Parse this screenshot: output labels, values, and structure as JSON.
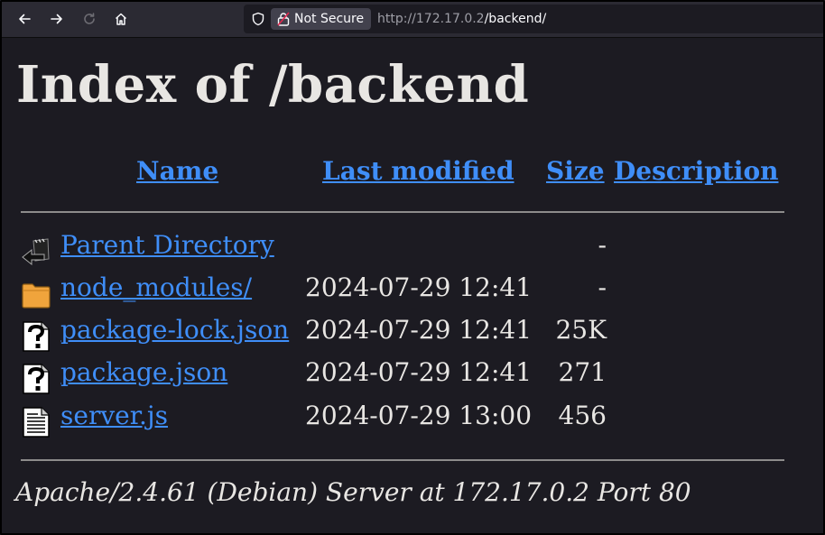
{
  "browser": {
    "security_label": "Not Secure",
    "url_host": "http://172.17.0.2",
    "url_path": "/backend/",
    "icons": [
      "back-icon",
      "forward-icon",
      "reload-icon",
      "home-icon",
      "shield-icon",
      "lock-warning-icon"
    ]
  },
  "page": {
    "title": "Index of /backend",
    "columns": {
      "name": "Name",
      "last_modified": "Last modified",
      "size": "Size",
      "description": "Description"
    },
    "rows": [
      {
        "icon": "back-folder-icon",
        "name": "Parent Directory",
        "modified": "",
        "size": "-"
      },
      {
        "icon": "folder-icon",
        "name": "node_modules/",
        "modified": "2024-07-29 12:41",
        "size": "-"
      },
      {
        "icon": "unknown-file-icon",
        "name": "package-lock.json",
        "modified": "2024-07-29 12:41",
        "size": "25K"
      },
      {
        "icon": "unknown-file-icon",
        "name": "package.json",
        "modified": "2024-07-29 12:41",
        "size": "271"
      },
      {
        "icon": "text-file-icon",
        "name": "server.js",
        "modified": "2024-07-29 13:00",
        "size": "456"
      }
    ],
    "footer": "Apache/2.4.61 (Debian) Server at 172.17.0.2 Port 80"
  },
  "colors": {
    "background": "#1c1b22",
    "toolbar": "#2b2a33",
    "link": "#3f8ef8",
    "text": "#e8e6e3"
  }
}
